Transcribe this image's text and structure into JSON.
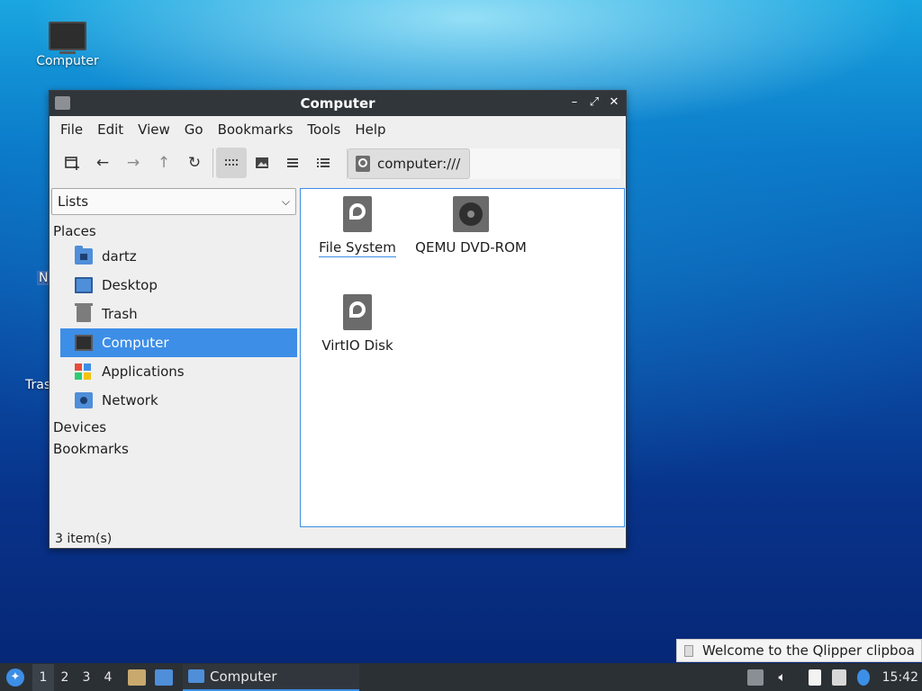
{
  "desktop": {
    "icons": [
      {
        "label": "Computer"
      }
    ],
    "partial_labels": [
      "N",
      "Tras"
    ]
  },
  "window": {
    "title": "Computer",
    "controls": {
      "minimize": "–",
      "maximize": "⤢",
      "close": "✕"
    },
    "menu": [
      "File",
      "Edit",
      "View",
      "Go",
      "Bookmarks",
      "Tools",
      "Help"
    ],
    "toolbar": {
      "new_tab_icon": "new-tab-icon",
      "back_icon": "arrow-left-icon",
      "forward_icon": "arrow-right-icon",
      "up_icon": "arrow-up-icon",
      "reload_icon": "reload-icon",
      "active_view": "icon-view",
      "location": "computer:///"
    },
    "side_panel": {
      "mode": "Lists",
      "places_heading": "Places",
      "places": [
        {
          "label": "dartz",
          "icon": "home-folder-icon",
          "selected": false
        },
        {
          "label": "Desktop",
          "icon": "desktop-icon",
          "selected": false
        },
        {
          "label": "Trash",
          "icon": "trash-icon",
          "selected": false
        },
        {
          "label": "Computer",
          "icon": "computer-icon",
          "selected": true
        },
        {
          "label": "Applications",
          "icon": "applications-icon",
          "selected": false
        },
        {
          "label": "Network",
          "icon": "network-icon",
          "selected": false
        }
      ],
      "devices_heading": "Devices",
      "bookmarks_heading": "Bookmarks"
    },
    "files": [
      {
        "label": "File System",
        "icon": "drive-icon"
      },
      {
        "label": "QEMU DVD-ROM",
        "icon": "cdrom-icon"
      },
      {
        "label": "VirtIO Disk",
        "icon": "drive-icon"
      }
    ],
    "status": "3 item(s)"
  },
  "notification": {
    "text": "Welcome to the Qlipper clipboa"
  },
  "taskbar": {
    "workspaces": [
      "1",
      "2",
      "3",
      "4"
    ],
    "active_workspace": "1",
    "task_label": "Computer",
    "clock": "15:42"
  },
  "colors": {
    "accent": "#3d8ee6",
    "titlebar": "#31363b",
    "taskbar": "#2b3035",
    "folder": "#4f8ed9"
  }
}
